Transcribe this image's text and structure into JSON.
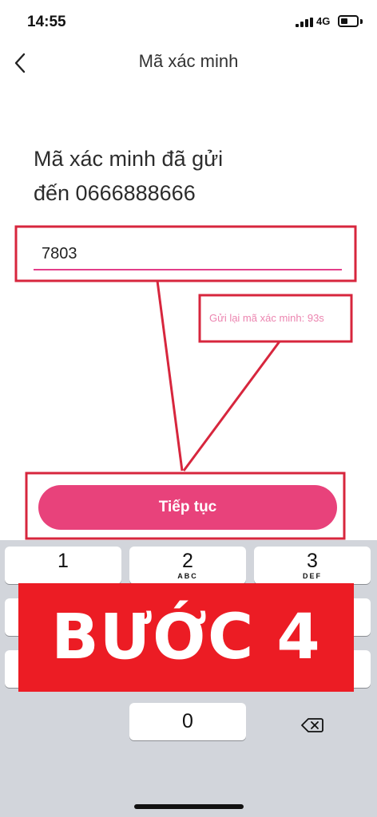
{
  "status_bar": {
    "time": "14:55",
    "network": "4G"
  },
  "header": {
    "title": "Mã xác minh"
  },
  "main": {
    "headline": "Mã xác minh đã gửi\nđến 0666888666",
    "code_value": "7803",
    "resend_text": "Gửi lại mã xác minh: 93s",
    "continue_label": "Tiếp tục"
  },
  "keypad": {
    "keys": [
      {
        "digit": "1",
        "letters": ""
      },
      {
        "digit": "2",
        "letters": "ABC"
      },
      {
        "digit": "3",
        "letters": "DEF"
      }
    ],
    "zero": "0"
  },
  "banner": {
    "text": "BƯỚC 4"
  },
  "colors": {
    "accent": "#e8427b",
    "annotation": "#d7263d",
    "banner": "#ec1c24"
  }
}
